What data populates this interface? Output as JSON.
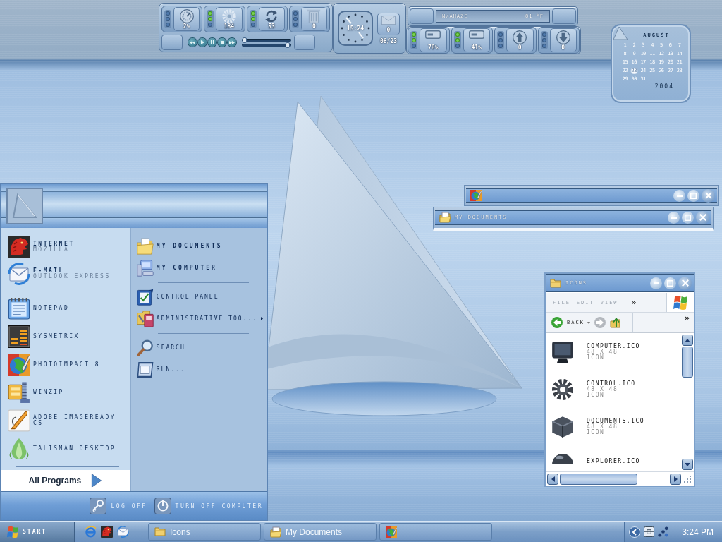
{
  "widgets": {
    "meters_top": [
      {
        "value": "2%",
        "lights": [
          {
            "on": false
          },
          {
            "on": false
          },
          {
            "on": false
          }
        ]
      },
      {
        "value": "184",
        "lights": [
          {
            "on": true
          },
          {
            "on": true
          },
          {
            "on": false
          }
        ]
      },
      {
        "value": "53",
        "lights": [
          {
            "on": true
          },
          {
            "on": true
          },
          {
            "on": false
          }
        ]
      },
      {
        "value": "0",
        "lights": [
          {
            "on": false
          },
          {
            "on": false
          },
          {
            "on": false
          }
        ]
      }
    ],
    "media": {
      "seek": {
        "level": 0.02
      },
      "volume": {
        "level": 0.97
      }
    },
    "clock": {
      "time": "15:24",
      "mail_count": "0",
      "date": "08/23"
    },
    "weather": {
      "condition": "N/AHAZE",
      "temperature": "81 °F"
    },
    "meters_bottom": [
      {
        "value": "78%",
        "lights": [
          {
            "on": true
          },
          {
            "on": true
          },
          {
            "on": false
          }
        ]
      },
      {
        "value": "41%",
        "lights": [
          {
            "on": true
          },
          {
            "on": true
          },
          {
            "on": false
          }
        ]
      },
      {
        "value": "0",
        "lights": [
          {
            "on": false
          },
          {
            "on": false
          },
          {
            "on": false
          }
        ]
      },
      {
        "value": "0",
        "lights": [
          {
            "on": false
          },
          {
            "on": false
          },
          {
            "on": false
          }
        ]
      }
    ]
  },
  "calendar": {
    "month": "AUGUST",
    "year": "2004",
    "days": [
      {
        "label": "1",
        "selected": false
      },
      {
        "label": "2",
        "selected": false
      },
      {
        "label": "3",
        "selected": false
      },
      {
        "label": "4",
        "selected": false
      },
      {
        "label": "5",
        "selected": false
      },
      {
        "label": "6",
        "selected": false
      },
      {
        "label": "7",
        "selected": false
      },
      {
        "label": "8",
        "selected": false
      },
      {
        "label": "9",
        "selected": false
      },
      {
        "label": "10",
        "selected": false
      },
      {
        "label": "11",
        "selected": false
      },
      {
        "label": "12",
        "selected": false
      },
      {
        "label": "13",
        "selected": false
      },
      {
        "label": "14",
        "selected": false
      },
      {
        "label": "15",
        "selected": false
      },
      {
        "label": "16",
        "selected": false
      },
      {
        "label": "17",
        "selected": false
      },
      {
        "label": "18",
        "selected": false
      },
      {
        "label": "19",
        "selected": false
      },
      {
        "label": "20",
        "selected": false
      },
      {
        "label": "21",
        "selected": false
      },
      {
        "label": "22",
        "selected": false
      },
      {
        "label": "23",
        "selected": true
      },
      {
        "label": "24",
        "selected": false
      },
      {
        "label": "25",
        "selected": false
      },
      {
        "label": "26",
        "selected": false
      },
      {
        "label": "27",
        "selected": false
      },
      {
        "label": "28",
        "selected": false
      },
      {
        "label": "29",
        "selected": false
      },
      {
        "label": "30",
        "selected": false
      },
      {
        "label": "31",
        "selected": false
      }
    ]
  },
  "start_menu": {
    "pinned": [
      {
        "title": "INTERNET",
        "subtitle": "MOZILLA"
      },
      {
        "title": "E-MAIL",
        "subtitle": "OUTLOOK EXPRESS"
      }
    ],
    "programs": [
      {
        "title": "NOTEPAD"
      },
      {
        "title": "SYSMETRIX"
      },
      {
        "title": "PHOTOIMPACT 8"
      },
      {
        "title": "WINZIP"
      },
      {
        "title": "ADOBE IMAGEREADY CS"
      },
      {
        "title": "TALISMAN DESKTOP"
      }
    ],
    "all_programs": "All Programs",
    "places": [
      {
        "items": [
          {
            "label": "MY DOCUMENTS",
            "submenu": false
          },
          {
            "label": "MY COMPUTER",
            "submenu": false
          }
        ]
      },
      {
        "items": [
          {
            "label": "CONTROL PANEL",
            "submenu": false
          },
          {
            "label": "ADMINISTRATIVE TOO...",
            "submenu": true
          }
        ]
      },
      {
        "items": [
          {
            "label": "SEARCH",
            "submenu": false
          },
          {
            "label": "RUN...",
            "submenu": false
          }
        ]
      }
    ],
    "log_off": "LOG OFF",
    "turn_off": "TURN OFF COMPUTER"
  },
  "windows": [
    {
      "kind": "app_shaded"
    },
    {
      "kind": "folder_shaded",
      "title": "MY DOCUMENTS"
    },
    {
      "kind": "explorer",
      "title": "ICONS",
      "menu": [
        "FILE",
        "EDIT",
        "VIEW"
      ],
      "menu_chevron": "»",
      "back": {
        "label": "BACK",
        "disabled": false
      },
      "forward": {
        "disabled": true
      },
      "toolbar_chevron": "»",
      "files": [
        {
          "name": "COMPUTER.ICO",
          "size": "48 X 48",
          "type": "ICON"
        },
        {
          "name": "CONTROL.ICO",
          "size": "48 X 48",
          "type": "ICON"
        },
        {
          "name": "DOCUMENTS.ICO",
          "size": "48 X 48",
          "type": "ICON"
        },
        {
          "name": "EXPLORER.ICO"
        }
      ]
    }
  ],
  "taskbar": {
    "start": "START",
    "tasks": [
      {
        "kind": "folder",
        "title": "Icons"
      },
      {
        "kind": "documents",
        "title": "My Documents"
      },
      {
        "kind": "app"
      }
    ],
    "clock": "3:24 PM"
  }
}
